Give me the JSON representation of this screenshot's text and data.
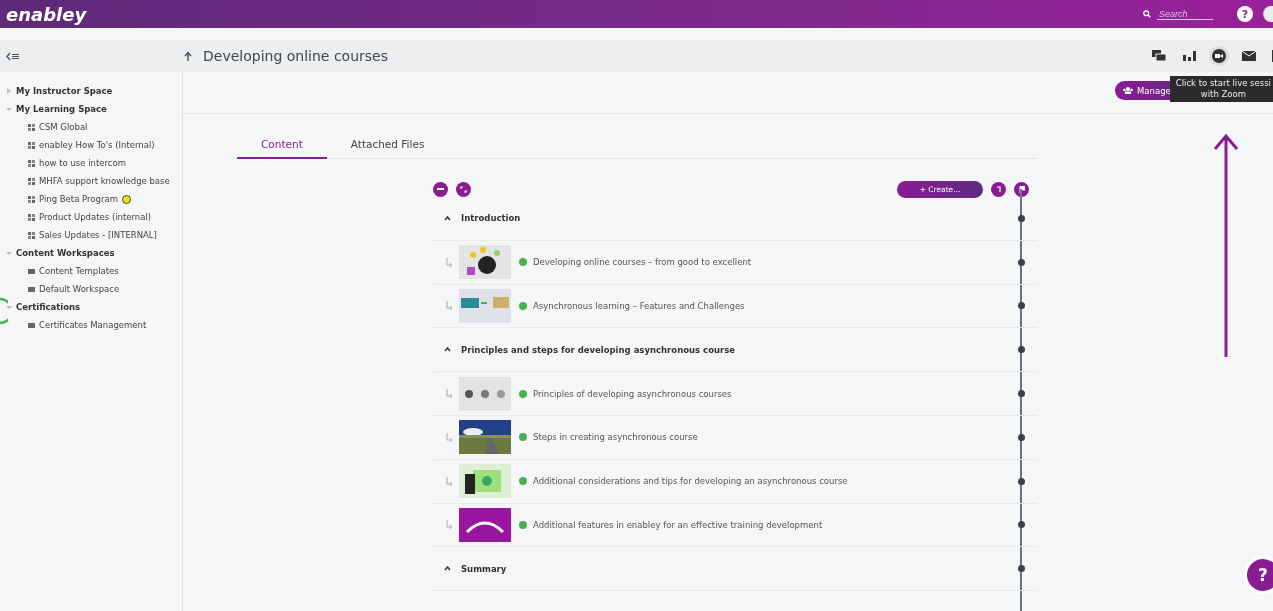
{
  "header": {
    "logo": "enabley",
    "search": {
      "placeholder": "Search"
    },
    "help": "?"
  },
  "toolbar": {
    "title": "Developing online courses",
    "tooltip": [
      "Click to start live sessi",
      "with Zoom"
    ]
  },
  "sidebar": {
    "items": [
      {
        "label": "My Instructor Space",
        "expanded": false
      },
      {
        "label": "My Learning Space",
        "expanded": true,
        "children": [
          {
            "label": "CSM Global",
            "kind": "space"
          },
          {
            "label": "enabley How To's (Internal)",
            "kind": "space"
          },
          {
            "label": "how to use intercom",
            "kind": "space"
          },
          {
            "label": "MHFA support knowledge base",
            "kind": "space"
          },
          {
            "label": "Ping Beta Program",
            "kind": "space",
            "color": "#f2e600"
          },
          {
            "label": "Product Updates (internal)",
            "kind": "space"
          },
          {
            "label": "Sales Updates - [INTERNAL]",
            "kind": "space"
          }
        ]
      },
      {
        "label": "Content Workspaces",
        "expanded": true,
        "children": [
          {
            "label": "Content Templates",
            "kind": "workspace"
          },
          {
            "label": "Default Workspace",
            "kind": "workspace"
          }
        ]
      },
      {
        "label": "Certifications",
        "expanded": true,
        "children": [
          {
            "label": "Certificates Management",
            "kind": "workspace"
          }
        ]
      }
    ]
  },
  "actions": {
    "manage": "Manage"
  },
  "tabs": [
    {
      "label": "Content",
      "selected": true
    },
    {
      "label": "Attached Files",
      "selected": false
    }
  ],
  "content": {
    "create": "+ Create...",
    "rows": [
      {
        "kind": "section",
        "title": "Introduction",
        "expanded": true
      },
      {
        "kind": "lesson",
        "title": "Developing online courses – from good to excellent",
        "color": "#4caf50"
      },
      {
        "kind": "lesson",
        "title": "Asynchronous learning – Features and Challenges",
        "color": "#4caf50"
      },
      {
        "kind": "section",
        "title": "Principles and steps for developing asynchronous course",
        "expanded": true
      },
      {
        "kind": "lesson",
        "title": "Principles of developing asynchronous courses",
        "color": "#4caf50"
      },
      {
        "kind": "lesson",
        "title": "Steps in creating asynchronous course",
        "color": "#4caf50"
      },
      {
        "kind": "lesson",
        "title": "Additional considerations and tips for developing an asynchronous course",
        "color": "#4caf50"
      },
      {
        "kind": "lesson",
        "title": "Additional features in enabley for an effective training development",
        "color": "#4caf50"
      },
      {
        "kind": "section",
        "title": "Summary",
        "expanded": true
      }
    ]
  },
  "fab": "?"
}
